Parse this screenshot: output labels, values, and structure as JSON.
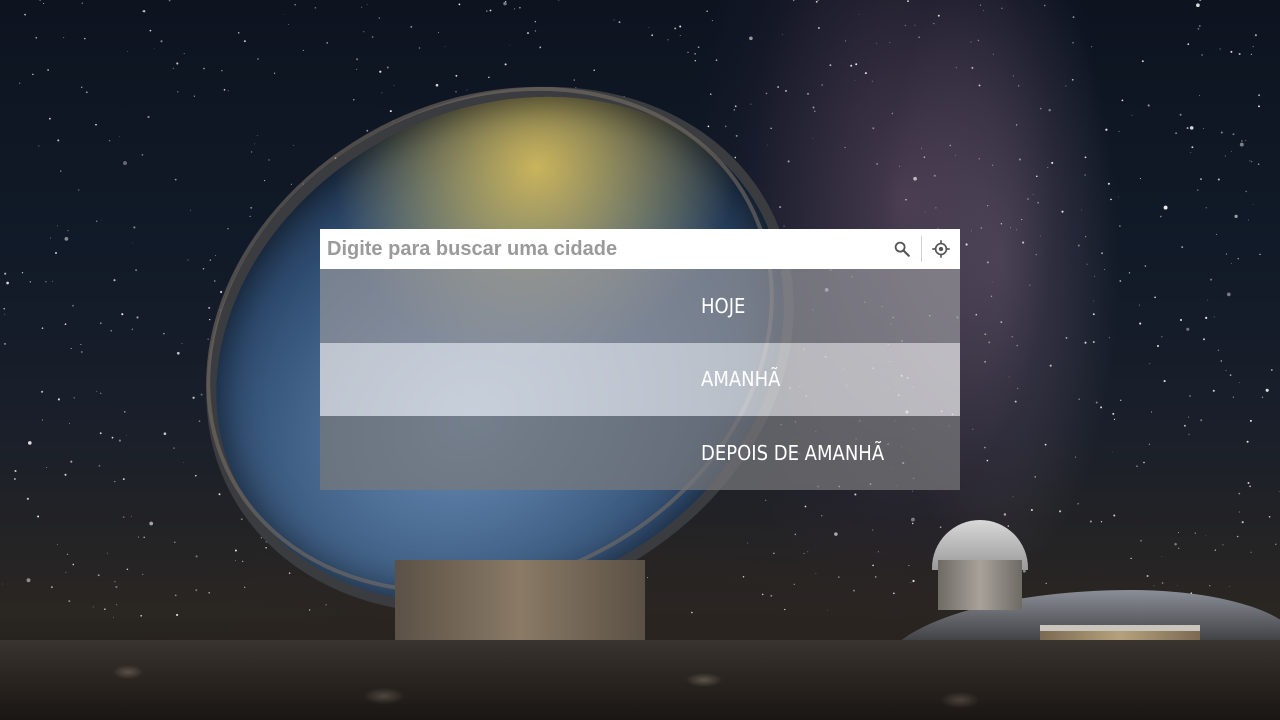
{
  "search": {
    "placeholder": "Digite para buscar uma cidade",
    "value": ""
  },
  "icons": {
    "search": "search-icon",
    "location": "location-target-icon"
  },
  "forecast_tabs": [
    {
      "label": "HOJE"
    },
    {
      "label": "AMANHÃ"
    },
    {
      "label": "DEPOIS DE AMANHÃ"
    }
  ],
  "colors": {
    "search_bar": "#ffffff",
    "placeholder": "#9a9a9a",
    "tab_text": "#ffffff"
  }
}
